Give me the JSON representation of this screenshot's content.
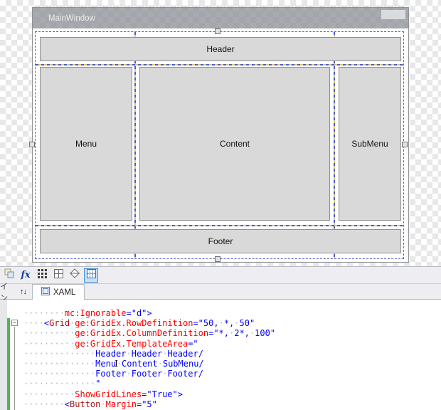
{
  "designer": {
    "window_title": "MainWindow",
    "cells": {
      "header": "Header",
      "menu": "Menu",
      "content": "Content",
      "submenu": "SubMenu",
      "footer": "Footer"
    }
  },
  "toolbar": {
    "effects_label": "fx"
  },
  "tabs": {
    "design_tab_partial": "イン",
    "swap_glyph": "↑↓",
    "xaml_label": "XAML"
  },
  "icons": {
    "fold_collapse_glyph": "−"
  },
  "colors": {
    "attr_red": "#ff0000",
    "element_brown": "#a31515",
    "value_blue": "#0000ff",
    "gridline_blue": "#4d5ec5",
    "change_bar_green": "#4fb54f"
  },
  "editor": {
    "lines": [
      {
        "tokens": [
          [
            "ws",
            "········"
          ],
          [
            "attr",
            "mc:Ignorable"
          ],
          [
            "val",
            "=\"d\">"
          ]
        ]
      },
      {
        "tokens": [
          [
            "ws",
            "····"
          ],
          [
            "val",
            "<"
          ],
          [
            "elem",
            "Grid"
          ],
          [
            "ws",
            "·"
          ],
          [
            "attr",
            "ge:GridEx.RowDefinition"
          ],
          [
            "val",
            "=\"50,"
          ],
          [
            "ws",
            "·"
          ],
          [
            "val",
            "*,"
          ],
          [
            "ws",
            "·"
          ],
          [
            "val",
            "50\""
          ]
        ]
      },
      {
        "tokens": [
          [
            "ws",
            "··········"
          ],
          [
            "attr",
            "ge:GridEx.ColumnDefinition"
          ],
          [
            "val",
            "=\"*,"
          ],
          [
            "ws",
            "·"
          ],
          [
            "val",
            "2*,"
          ],
          [
            "ws",
            "·"
          ],
          [
            "val",
            "100\""
          ]
        ]
      },
      {
        "tokens": [
          [
            "ws",
            "··········"
          ],
          [
            "attr",
            "ge:GridEx.TemplateArea"
          ],
          [
            "val",
            "=\""
          ]
        ]
      },
      {
        "tokens": [
          [
            "ws",
            "··············"
          ],
          [
            "val",
            "Header"
          ],
          [
            "ws",
            "·"
          ],
          [
            "val",
            "Header"
          ],
          [
            "ws",
            "·"
          ],
          [
            "val",
            "Header/"
          ]
        ]
      },
      {
        "tokens": [
          [
            "ws",
            "··············"
          ],
          [
            "val",
            "Menu"
          ],
          [
            "caret",
            "I"
          ],
          [
            "ws",
            "·"
          ],
          [
            "val",
            "Content"
          ],
          [
            "ws",
            "·"
          ],
          [
            "val",
            "SubMenu/"
          ]
        ]
      },
      {
        "tokens": [
          [
            "ws",
            "··············"
          ],
          [
            "val",
            "Footer"
          ],
          [
            "ws",
            "·"
          ],
          [
            "val",
            "Footer"
          ],
          [
            "ws",
            "·"
          ],
          [
            "val",
            "Footer/"
          ]
        ]
      },
      {
        "tokens": [
          [
            "ws",
            "··············"
          ],
          [
            "val",
            "\""
          ]
        ]
      },
      {
        "tokens": [
          [
            "ws",
            "··········"
          ],
          [
            "attr",
            "ShowGridLines"
          ],
          [
            "val",
            "=\"True\">"
          ]
        ]
      },
      {
        "tokens": [
          [
            "ws",
            "········"
          ],
          [
            "val",
            "<"
          ],
          [
            "elem",
            "Button"
          ],
          [
            "ws",
            "·"
          ],
          [
            "attr",
            "Margin"
          ],
          [
            "val",
            "=\"5\""
          ]
        ]
      }
    ]
  }
}
